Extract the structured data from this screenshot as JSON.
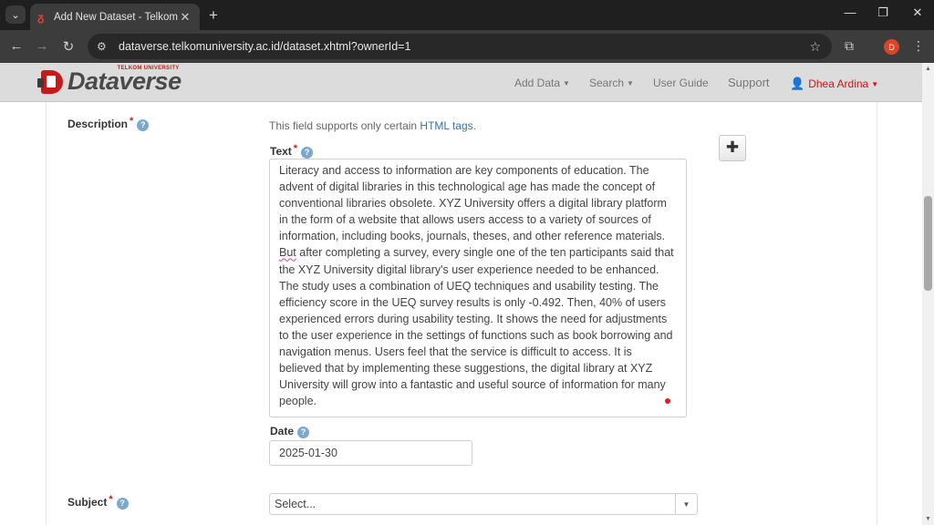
{
  "browser": {
    "tab_title": "Add New Dataset - Telkom Univ",
    "url": "dataverse.telkomuniversity.ac.id/dataset.xhtml?ownerId=1",
    "profile_initial": "D"
  },
  "header": {
    "logo_top": "TELKOM UNIVERSITY",
    "logo_text": "Dataverse",
    "nav": {
      "add_data": "Add Data",
      "search": "Search",
      "user_guide": "User Guide",
      "support": "Support",
      "user": "Dhea Ardina"
    }
  },
  "form": {
    "description_label": "Description",
    "hint_prefix": "This field supports only certain ",
    "hint_link": "HTML tags",
    "hint_suffix": ".",
    "text_label": "Text",
    "text_value_part1": "Literacy and access to information are key components of education. The advent of digital libraries in this technological age has made the concept of conventional libraries obsolete. XYZ University offers a digital library platform in the form of a website that allows users access to a variety of sources of information, including books, journals, theses, and other reference materials. ",
    "text_value_spell": "But",
    "text_value_part2": " after completing a survey, every single one of the ten participants said that the XYZ University digital library's user experience needed to be enhanced. The study uses a combination of UEQ techniques and usability testing. The efficiency score in the UEQ survey results is only -0.492. Then, 40% of users experienced errors during usability testing. It shows the need for adjustments to the user experience in the settings of functions such as book borrowing and navigation menus. Users feel that the service is difficult to access. It is believed that by implementing these suggestions, the digital library at XYZ University will grow into a fantastic and useful source of information for many people.",
    "date_label": "Date",
    "date_value": "2025-01-30",
    "subject_label": "Subject",
    "subject_value": "Select..."
  },
  "colors": {
    "accent_red": "#c8191a",
    "link_blue": "#3572a8",
    "help_blue": "#7aa8cf"
  }
}
